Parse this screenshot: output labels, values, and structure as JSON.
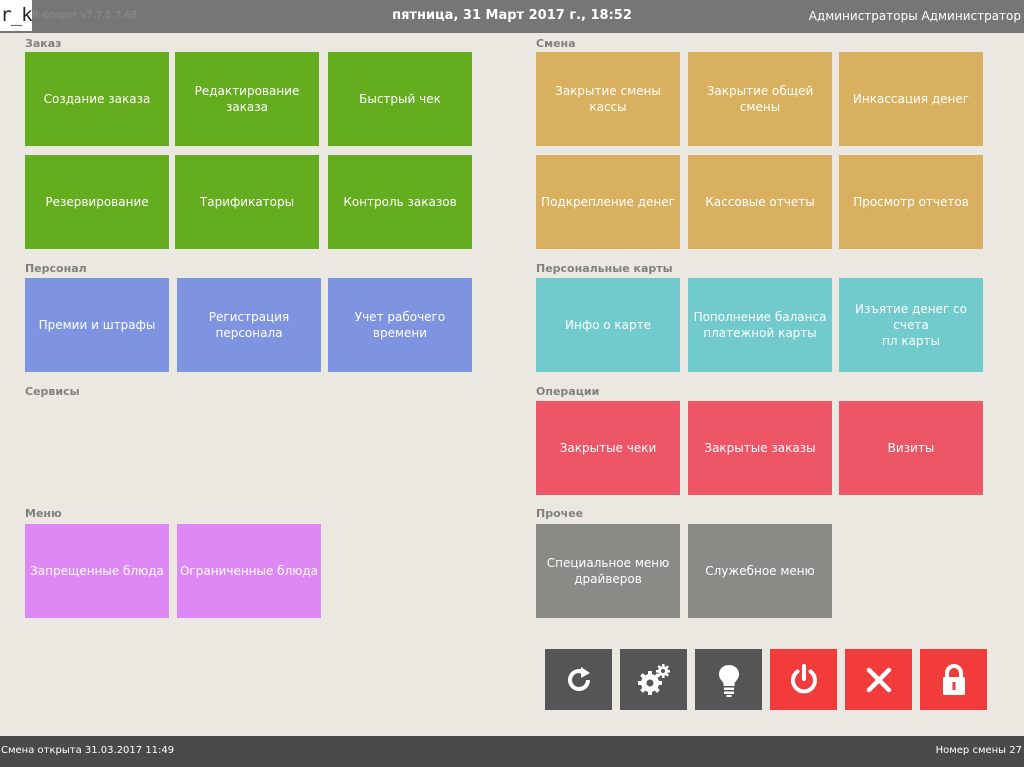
{
  "header": {
    "logo": "r_k",
    "version": "R-Keeper v7.7.5.7.68",
    "datetime": "пятница, 31 Март 2017 г., 18:52",
    "user": "Администраторы Администратор"
  },
  "sections": {
    "order": {
      "title": "Заказ",
      "items": [
        "Создание заказа",
        "Редактирование заказа",
        "Быстрый чек",
        "Резервирование",
        "Тарификаторы",
        "Контроль заказов"
      ]
    },
    "shift": {
      "title": "Смена",
      "items": [
        "Закрытие смены кассы",
        "Закрытие общей смены",
        "Инкассация денег",
        "Подкрепление денег",
        "Кассовые отчеты",
        "Просмотр отчетов"
      ]
    },
    "personnel": {
      "title": "Персонал",
      "items": [
        "Премии и штрафы",
        "Регистрация персонала",
        "Учет рабочего времени"
      ]
    },
    "cards": {
      "title": "Персональные карты",
      "items": [
        "Инфо о карте",
        "Пополнение баланса\nплатежной карты",
        "Изъятие денег со счета\nпл карты"
      ]
    },
    "services": {
      "title": "Сервисы",
      "items": []
    },
    "operations": {
      "title": "Операции",
      "items": [
        "Закрытые чеки",
        "Закрытые заказы",
        "Визиты"
      ]
    },
    "menu": {
      "title": "Меню",
      "items": [
        "Запрещенные блюда",
        "Ограниченные блюда"
      ]
    },
    "other": {
      "title": "Прочее",
      "items": [
        "Специальное меню\nдрайверов",
        "Служебное меню"
      ]
    }
  },
  "actions": [
    {
      "icon": "refresh-icon",
      "color": "#555555"
    },
    {
      "icon": "gears-icon",
      "color": "#555555"
    },
    {
      "icon": "lightbulb-icon",
      "color": "#555555"
    },
    {
      "icon": "power-icon",
      "color": "#f23b3b"
    },
    {
      "icon": "close-icon",
      "color": "#f23b3b"
    },
    {
      "icon": "lock-icon",
      "color": "#f23b3b"
    }
  ],
  "colors": {
    "order": "#64ad1e",
    "shift": "#d8b05f",
    "personnel": "#7f94e0",
    "cards": "#71cbcc",
    "operations": "#ec5667",
    "menu": "#dd88f4",
    "other": "#8a8a86"
  },
  "status": {
    "shift_opened": "Смена открыта 31.03.2017 11:49",
    "shift_number": "Номер смены 27"
  }
}
